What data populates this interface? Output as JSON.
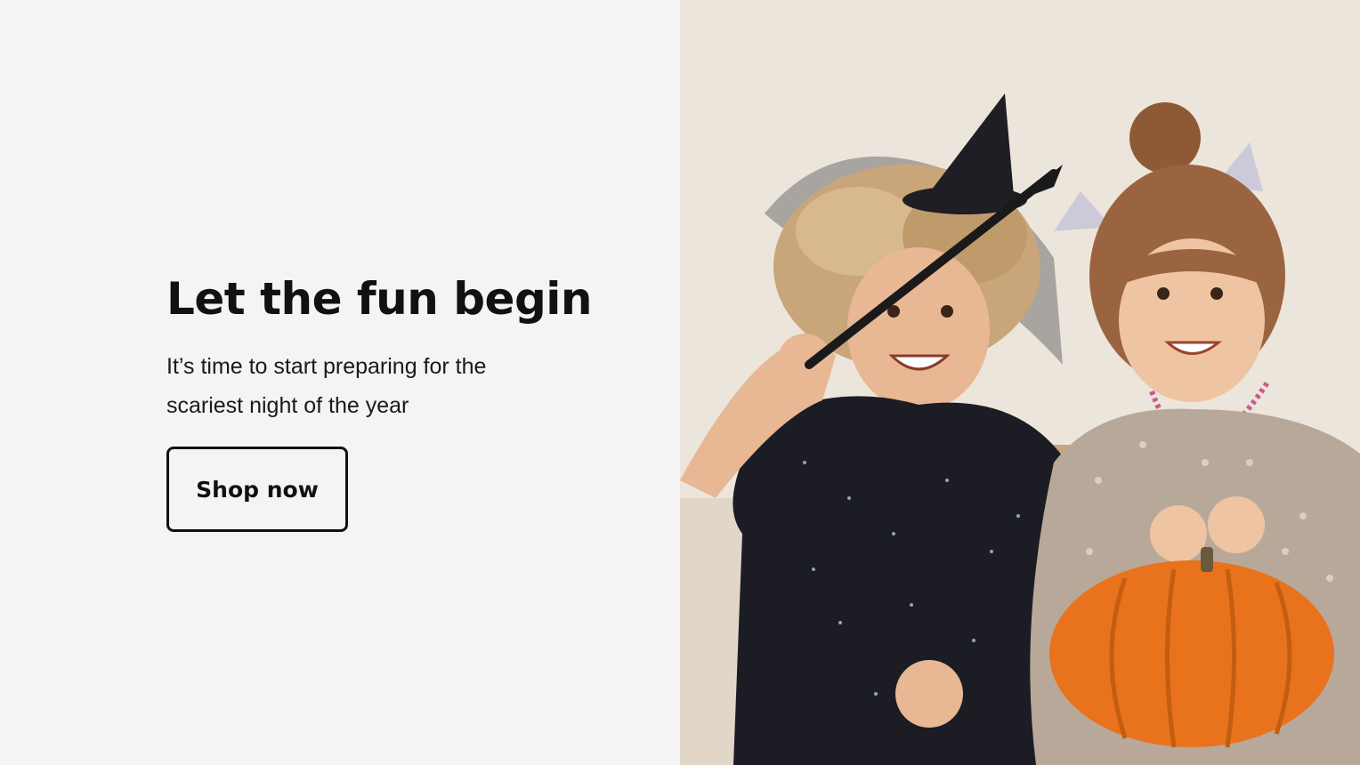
{
  "promo": {
    "headline": "Let the fun begin",
    "subtext": "It’s time to start preparing for the scariest night of the year",
    "cta_label": "Shop now"
  },
  "colors": {
    "background": "#f4f4f4",
    "text": "#111111",
    "pumpkin": "#e8731c",
    "dress_dark": "#1c1c24"
  },
  "icons": {
    "hero_image": "halloween-kids-photo"
  }
}
